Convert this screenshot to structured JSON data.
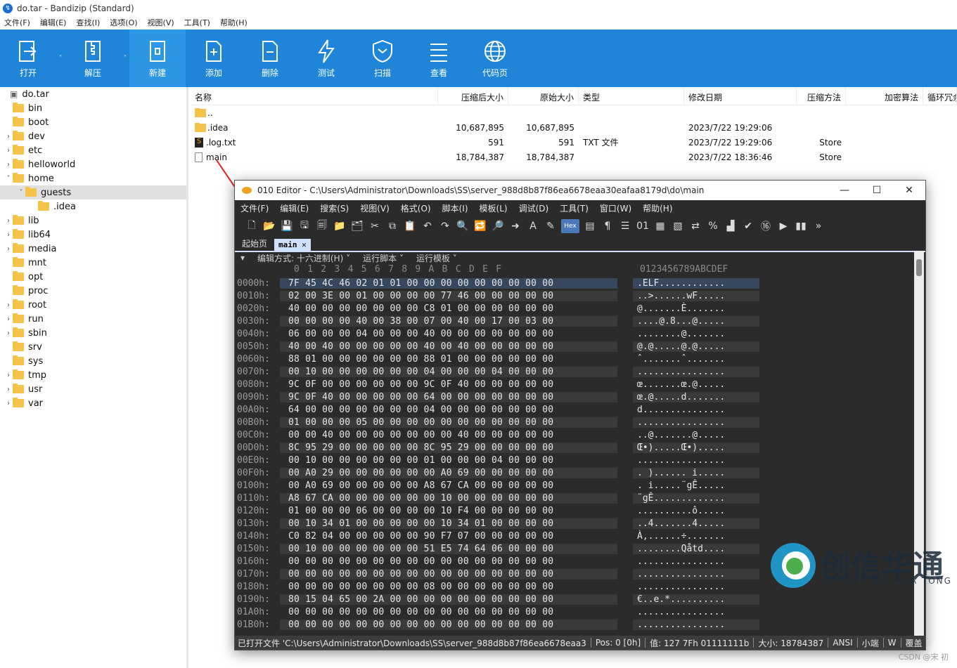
{
  "window": {
    "title": "do.tar - Bandizip (Standard)"
  },
  "menu": [
    "文件(F)",
    "编辑(E)",
    "查找(I)",
    "选项(O)",
    "视图(V)",
    "工具(T)",
    "帮助(H)"
  ],
  "ribbon": [
    {
      "label": "打开",
      "icon": "open-icon",
      "drop": true
    },
    {
      "label": "解压",
      "icon": "extract-icon",
      "drop": true
    },
    {
      "label": "新建",
      "icon": "new-archive-icon",
      "drop": false
    },
    {
      "label": "添加",
      "icon": "add-file-icon",
      "drop": false
    },
    {
      "label": "删除",
      "icon": "delete-file-icon",
      "drop": false
    },
    {
      "label": "测试",
      "icon": "test-icon",
      "drop": false
    },
    {
      "label": "扫描",
      "icon": "scan-shield-icon",
      "drop": false
    },
    {
      "label": "查看",
      "icon": "view-list-icon",
      "drop": false
    },
    {
      "label": "代码页",
      "icon": "codepage-globe-icon",
      "drop": false
    }
  ],
  "tree": [
    {
      "label": "do.tar",
      "level": 0,
      "chev": "",
      "root": true
    },
    {
      "label": "bin",
      "level": 1,
      "chev": ""
    },
    {
      "label": "boot",
      "level": 1,
      "chev": ""
    },
    {
      "label": "dev",
      "level": 1,
      "chev": "›"
    },
    {
      "label": "etc",
      "level": 1,
      "chev": "›"
    },
    {
      "label": "helloworld",
      "level": 1,
      "chev": "›"
    },
    {
      "label": "home",
      "level": 1,
      "chev": "˅"
    },
    {
      "label": "guests",
      "level": 2,
      "chev": "˅",
      "selected": true
    },
    {
      "label": ".idea",
      "level": 3,
      "chev": ""
    },
    {
      "label": "lib",
      "level": 1,
      "chev": "›"
    },
    {
      "label": "lib64",
      "level": 1,
      "chev": "›"
    },
    {
      "label": "media",
      "level": 1,
      "chev": "›"
    },
    {
      "label": "mnt",
      "level": 1,
      "chev": ""
    },
    {
      "label": "opt",
      "level": 1,
      "chev": ""
    },
    {
      "label": "proc",
      "level": 1,
      "chev": ""
    },
    {
      "label": "root",
      "level": 1,
      "chev": "›"
    },
    {
      "label": "run",
      "level": 1,
      "chev": "›"
    },
    {
      "label": "sbin",
      "level": 1,
      "chev": "›"
    },
    {
      "label": "srv",
      "level": 1,
      "chev": ""
    },
    {
      "label": "sys",
      "level": 1,
      "chev": ""
    },
    {
      "label": "tmp",
      "level": 1,
      "chev": "›"
    },
    {
      "label": "usr",
      "level": 1,
      "chev": "›"
    },
    {
      "label": "var",
      "level": 1,
      "chev": "›"
    }
  ],
  "columns": [
    "名称",
    "压缩后大小",
    "原始大小",
    "类型",
    "修改日期",
    "压缩方法",
    "加密算法",
    "循环冗余"
  ],
  "files": [
    {
      "name": "..",
      "kind": "folder",
      "packed": "",
      "size": "",
      "type": "",
      "date": "",
      "method": ""
    },
    {
      "name": ".idea",
      "kind": "folder",
      "packed": "10,687,895",
      "size": "10,687,895",
      "type": "",
      "date": "2023/7/22 19:29:06",
      "method": ""
    },
    {
      "name": ".log.txt",
      "kind": "txt",
      "packed": "591",
      "size": "591",
      "type": "TXT 文件",
      "date": "2023/7/22 19:29:06",
      "method": "Store"
    },
    {
      "name": "main",
      "kind": "file",
      "packed": "18,784,387",
      "size": "18,784,387",
      "type": "",
      "date": "2023/7/22 18:36:46",
      "method": "Store"
    }
  ],
  "editor": {
    "title": "010 Editor - C:\\Users\\Administrator\\Downloads\\SS\\server_988d8b87f86ea6678eaa30eafaa8179d\\do\\main",
    "menu": [
      "文件(F)",
      "编辑(E)",
      "搜索(S)",
      "视图(V)",
      "格式(O)",
      "脚本(I)",
      "模板(L)",
      "调试(D)",
      "工具(T)",
      "窗口(W)",
      "帮助(H)"
    ],
    "tabs": {
      "start": "起始页",
      "file": "main"
    },
    "sub": [
      "编辑方式: 十六进制(H)",
      "运行脚本",
      "运行模板"
    ],
    "hex_header": "0  1  2  3  4  5  6  7  8  9  A  B  C  D  E  F",
    "ascii_header": "0123456789ABCDEF",
    "rows": [
      [
        "0000h:",
        "7F 45 4C 46 02 01 01 00 00 00 00 00 00 00 00 00",
        ".ELF............"
      ],
      [
        "0010h:",
        "02 00 3E 00 01 00 00 00 00 77 46 00 00 00 00 00",
        "..>......wF....."
      ],
      [
        "0020h:",
        "40 00 00 00 00 00 00 00 C8 01 00 00 00 00 00 00",
        "@.......È......."
      ],
      [
        "0030h:",
        "00 00 00 00 40 00 38 00 07 00 40 00 17 00 03 00",
        "....@.8...@....."
      ],
      [
        "0040h:",
        "06 00 00 00 04 00 00 00 40 00 00 00 00 00 00 00",
        "........@......."
      ],
      [
        "0050h:",
        "40 00 40 00 00 00 00 00 40 00 40 00 00 00 00 00",
        "@.@.....@.@....."
      ],
      [
        "0060h:",
        "88 01 00 00 00 00 00 00 88 01 00 00 00 00 00 00",
        "ˆ.......ˆ......."
      ],
      [
        "0070h:",
        "00 10 00 00 00 00 00 00 04 00 00 00 04 00 00 00",
        "................"
      ],
      [
        "0080h:",
        "9C 0F 00 00 00 00 00 00 9C 0F 40 00 00 00 00 00",
        "œ.......œ.@....."
      ],
      [
        "0090h:",
        "9C 0F 40 00 00 00 00 00 64 00 00 00 00 00 00 00",
        "œ.@.....d......."
      ],
      [
        "00A0h:",
        "64 00 00 00 00 00 00 00 04 00 00 00 00 00 00 00",
        "d..............."
      ],
      [
        "00B0h:",
        "01 00 00 00 05 00 00 00 00 00 00 00 00 00 00 00",
        "................"
      ],
      [
        "00C0h:",
        "00 00 40 00 00 00 00 00 00 00 40 00 00 00 00 00",
        "..@.......@....."
      ],
      [
        "00D0h:",
        "8C 95 29 00 00 00 00 00 8C 95 29 00 00 00 00 00",
        "Œ•).....Œ•)....."
      ],
      [
        "00E0h:",
        "00 10 00 00 00 00 00 00 01 00 00 00 04 00 00 00",
        "................"
      ],
      [
        "00F0h:",
        "00 A0 29 00 00 00 00 00 00 A0 69 00 00 00 00 00",
        ". )...... i....."
      ],
      [
        "0100h:",
        "00 A0 69 00 00 00 00 00 A8 67 CA 00 00 00 00 00",
        ". i.....¨gÊ....."
      ],
      [
        "0110h:",
        "A8 67 CA 00 00 00 00 00 00 10 00 00 00 00 00 00",
        "¨gÊ............."
      ],
      [
        "0120h:",
        "01 00 00 00 06 00 00 00 00 10 F4 00 00 00 00 00",
        "..........ô....."
      ],
      [
        "0130h:",
        "00 10 34 01 00 00 00 00 00 10 34 01 00 00 00 00",
        "..4.......4....."
      ],
      [
        "0140h:",
        "C0 82 04 00 00 00 00 00 90 F7 07 00 00 00 00 00",
        "À‚......÷......."
      ],
      [
        "0150h:",
        "00 10 00 00 00 00 00 00 51 E5 74 64 06 00 00 00",
        "........Qåtd...."
      ],
      [
        "0160h:",
        "00 00 00 00 00 00 00 00 00 00 00 00 00 00 00 00",
        "................"
      ],
      [
        "0170h:",
        "00 00 00 00 00 00 00 00 00 00 00 00 00 00 00 00",
        "................"
      ],
      [
        "0180h:",
        "00 00 00 00 00 00 00 00 08 00 00 00 00 00 00 00",
        "................"
      ],
      [
        "0190h:",
        "80 15 04 65 00 2A 00 00 00 00 00 00 00 00 00 00",
        "€..e.*.........."
      ],
      [
        "01A0h:",
        "00 00 00 00 00 00 00 00 00 00 00 00 00 00 00 00",
        "................"
      ],
      [
        "01B0h:",
        "00 00 00 00 00 00 00 00 00 00 00 00 00 00 00 00",
        "................"
      ]
    ],
    "status": [
      "已打开文件 'C:\\Users\\Administrator\\Downloads\\SS\\server_988d8b87f86ea6678eaa3",
      "Pos: 0 [0h]",
      "值: 127 7Fh 01111111b",
      "大小: 18784387",
      "ANSI",
      "小端",
      "W",
      "覆盖"
    ]
  },
  "watermark": {
    "cn": "创信华通",
    "en": "CHUANG XIN HUA TONG"
  },
  "credit": "CSDN @宋 初"
}
